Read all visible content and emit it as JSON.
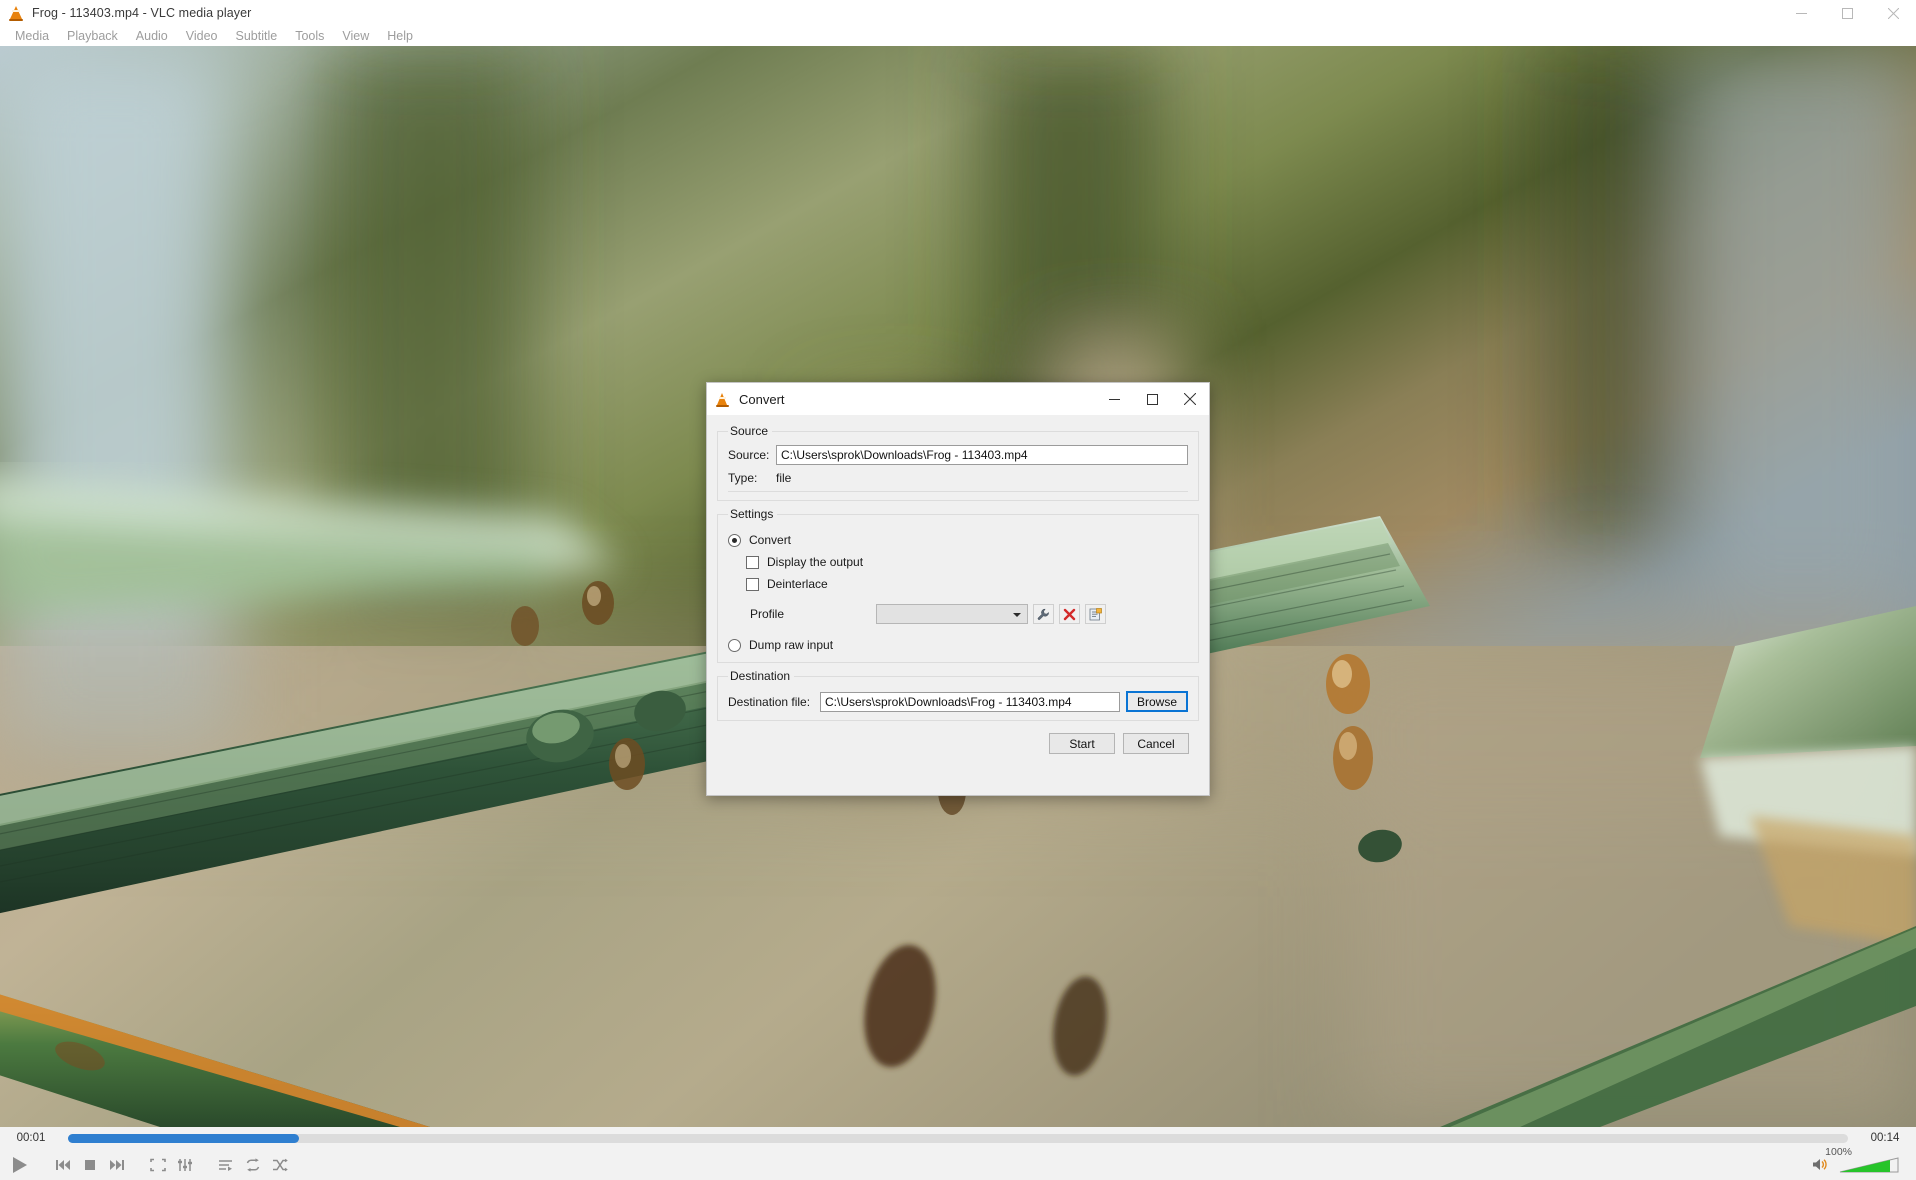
{
  "window": {
    "title": "Frog - 113403.mp4 - VLC media player",
    "icon": "vlc-cone-icon",
    "minimize": "minimize-icon",
    "maximize": "maximize-icon",
    "close": "close-icon"
  },
  "menubar": {
    "items": [
      {
        "label": "Media"
      },
      {
        "label": "Playback"
      },
      {
        "label": "Audio"
      },
      {
        "label": "Video"
      },
      {
        "label": "Subtitle"
      },
      {
        "label": "Tools"
      },
      {
        "label": "View"
      },
      {
        "label": "Help"
      }
    ]
  },
  "player": {
    "elapsed": "00:01",
    "total": "00:14",
    "progress_percent": 13,
    "progress_color": "#2f7fd0",
    "volume_label": "100%",
    "volume_percent": 100,
    "volume_color": "#27c42a",
    "controls": [
      {
        "name": "play-button"
      },
      {
        "name": "previous-button"
      },
      {
        "name": "stop-button"
      },
      {
        "name": "next-button"
      },
      {
        "name": "fullscreen-button"
      },
      {
        "name": "equalizer-button"
      },
      {
        "name": "playlist-button"
      },
      {
        "name": "loop-button"
      },
      {
        "name": "shuffle-button"
      }
    ]
  },
  "dialog": {
    "title": "Convert",
    "icon": "vlc-cone-icon",
    "titlebar_buttons": {
      "minimize": "minimize-icon",
      "maximize": "maximize-icon",
      "close": "close-icon"
    },
    "source": {
      "legend": "Source",
      "source_label": "Source:",
      "source_value": "C:\\Users\\sprok\\Downloads\\Frog - 113403.mp4",
      "type_label": "Type:",
      "type_value": "file"
    },
    "settings": {
      "legend": "Settings",
      "convert_radio": {
        "label": "Convert",
        "checked": true
      },
      "display_output_checkbox": {
        "label": "Display the output",
        "checked": false
      },
      "deinterlace_checkbox": {
        "label": "Deinterlace",
        "checked": false
      },
      "profile_label": "Profile",
      "profile_value": "",
      "profile_buttons": [
        {
          "name": "edit-profile-button",
          "icon": "wrench-icon"
        },
        {
          "name": "delete-profile-button",
          "icon": "red-x-icon"
        },
        {
          "name": "new-profile-button",
          "icon": "new-profile-icon"
        }
      ],
      "dump_raw_radio": {
        "label": "Dump raw input",
        "checked": false
      }
    },
    "destination": {
      "legend": "Destination",
      "file_label": "Destination file:",
      "file_value": "C:\\Users\\sprok\\Downloads\\Frog - 113403.mp4",
      "browse_label": "Browse",
      "browse_focused": true
    },
    "footer": {
      "start_label": "Start",
      "cancel_label": "Cancel"
    }
  }
}
